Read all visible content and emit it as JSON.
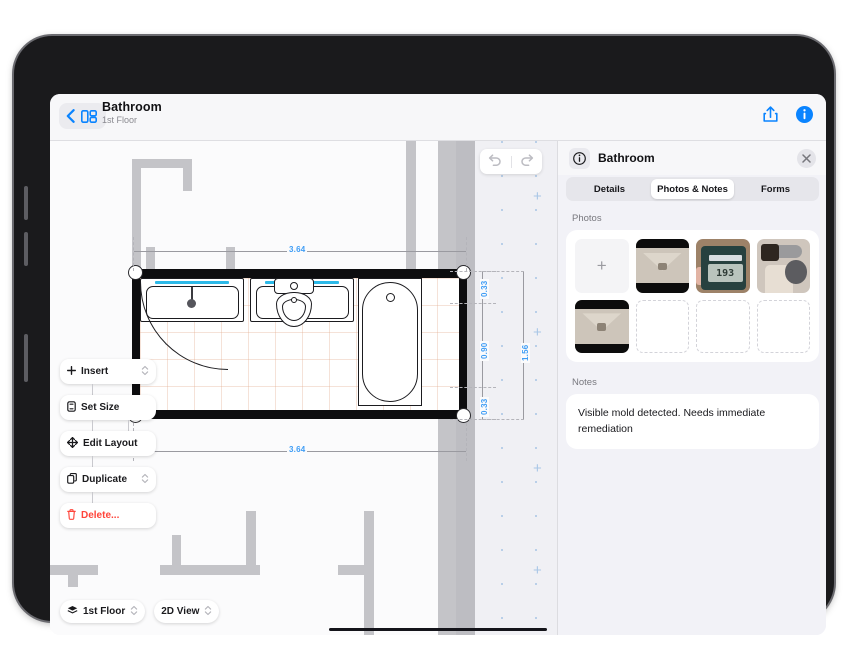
{
  "app": {
    "nav": {
      "back_icon": "chevron-left-icon",
      "plan_icon": "floorplan-icon",
      "title": "Bathroom",
      "subtitle": "1st Floor",
      "share_icon": "share-icon",
      "info_icon": "info-circle-icon"
    },
    "canvas": {
      "undo_icon": "undo-arrow-icon",
      "redo_icon": "redo-arrow-icon",
      "dimensions": {
        "top_width": "3.64",
        "bottom_width": "3.64",
        "right_segment_top": "0.33",
        "right_segment_middle": "0.90",
        "right_segment_bottom": "0.33",
        "right_total": "1.56"
      },
      "fixtures": [
        "sink-left",
        "sink-right",
        "toilet",
        "bathtub",
        "door-swing"
      ]
    },
    "toolbar": [
      {
        "label": "Insert",
        "icon": "plus-icon",
        "stepper": true,
        "danger": false
      },
      {
        "label": "Set Size",
        "icon": "resize-icon",
        "stepper": false,
        "danger": false
      },
      {
        "label": "Edit Layout",
        "icon": "move-arrows-icon",
        "stepper": false,
        "danger": false
      },
      {
        "label": "Duplicate",
        "icon": "copy-icon",
        "stepper": true,
        "danger": false
      },
      {
        "label": "Delete...",
        "icon": "trash-icon",
        "stepper": false,
        "danger": true
      }
    ],
    "bottom_pickers": [
      {
        "label": "1st Floor",
        "icon": "layers-icon",
        "stepper": true
      },
      {
        "label": "2D View",
        "icon": "",
        "stepper": true
      }
    ]
  },
  "inspector": {
    "header": {
      "icon": "info-circle-icon",
      "title": "Bathroom",
      "close_icon": "close-icon"
    },
    "tabs": [
      {
        "label": "Details",
        "active": false
      },
      {
        "label": "Photos & Notes",
        "active": true
      },
      {
        "label": "Forms",
        "active": false
      }
    ],
    "photos": {
      "section_label": "Photos",
      "add_icon": "plus-icon",
      "items": [
        {
          "kind": "add",
          "caption": ""
        },
        {
          "kind": "envelope",
          "caption": ""
        },
        {
          "kind": "meter",
          "caption": "193"
        },
        {
          "kind": "faucet",
          "caption": ""
        },
        {
          "kind": "envelope",
          "caption": ""
        },
        {
          "kind": "empty",
          "caption": ""
        },
        {
          "kind": "empty",
          "caption": ""
        },
        {
          "kind": "empty",
          "caption": ""
        }
      ]
    },
    "notes": {
      "section_label": "Notes",
      "text": "Visible mold detected. Needs immediate remediation"
    }
  },
  "colors": {
    "accent_blue": "#0a84ff",
    "dimension_blue": "#3f9df5",
    "danger_red": "#ff443a",
    "counter_cyan": "#2bb9e8",
    "panel_bg": "#f2f2f7"
  }
}
